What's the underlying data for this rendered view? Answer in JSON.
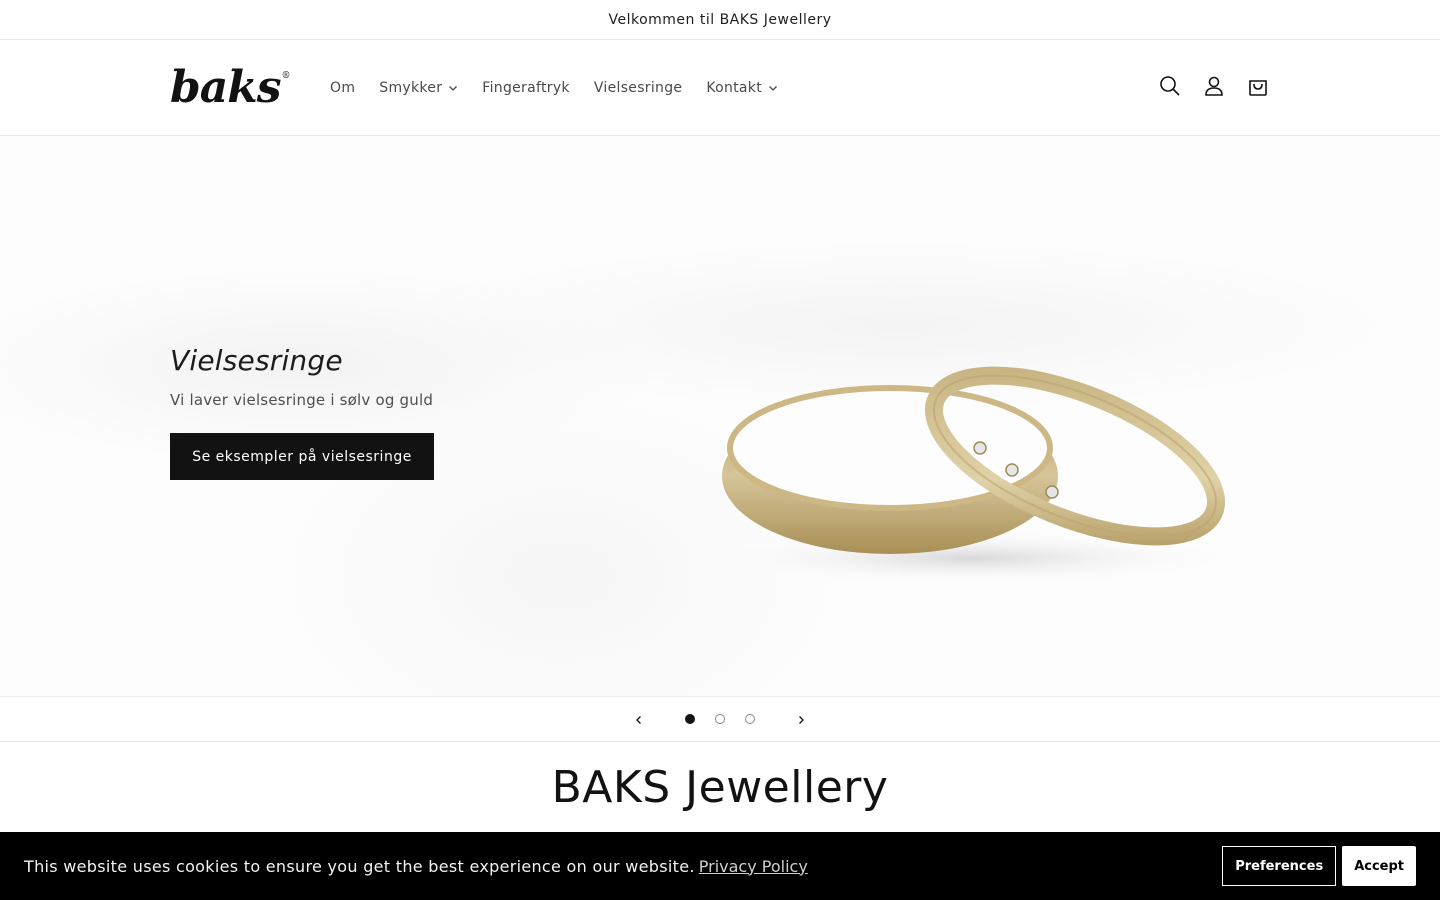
{
  "announcement": {
    "text": "Velkommen til BAKS Jewellery"
  },
  "header": {
    "logo_text": "baks",
    "logo_mark": "®",
    "nav": [
      {
        "label": "Om",
        "has_dropdown": false
      },
      {
        "label": "Smykker",
        "has_dropdown": true
      },
      {
        "label": "Fingeraftryk",
        "has_dropdown": false
      },
      {
        "label": "Vielsesringe",
        "has_dropdown": false
      },
      {
        "label": "Kontakt",
        "has_dropdown": true
      }
    ],
    "icons": [
      "search-icon",
      "account-icon",
      "cart-icon"
    ]
  },
  "hero": {
    "title": "Vielsesringe",
    "subtitle": "Vi laver vielsesringe i sølv og guld",
    "button_label": "Se eksempler på vielsesringe",
    "image": "gold-wedding-rings"
  },
  "slider": {
    "slides": 3,
    "active_index": 0
  },
  "section": {
    "title": "BAKS Jewellery"
  },
  "cookie_banner": {
    "text": "This website uses cookies to ensure you get the best experience on our website.",
    "link_label": "Privacy Policy",
    "preferences_label": "Preferences",
    "accept_label": "Accept"
  },
  "colors": {
    "text": "#121212",
    "button_bg": "#121212",
    "banner_bg": "#000000",
    "gold": "#c9b27a"
  }
}
